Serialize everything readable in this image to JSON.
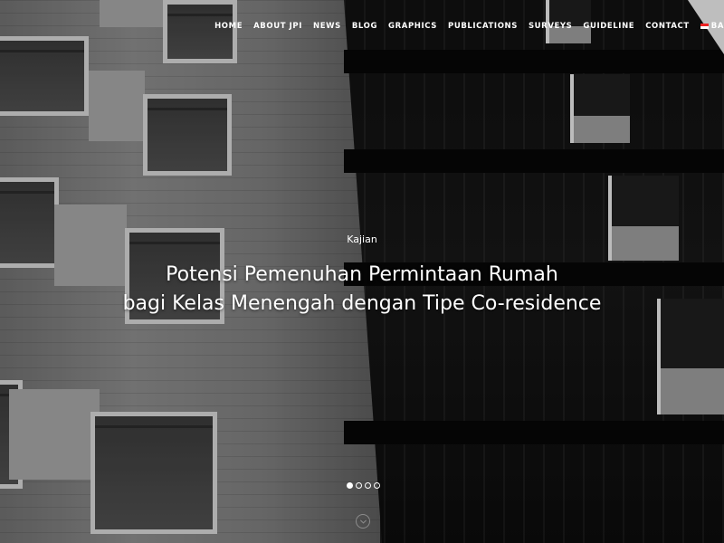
{
  "nav": {
    "items": [
      {
        "label": "HOME"
      },
      {
        "label": "ABOUT JPI"
      },
      {
        "label": "NEWS"
      },
      {
        "label": "BLOG"
      },
      {
        "label": "GRAPHICS"
      },
      {
        "label": "PUBLICATIONS"
      },
      {
        "label": "SURVEYS"
      },
      {
        "label": "GUIDELINE"
      },
      {
        "label": "CONTACT"
      }
    ],
    "language_label": "BA"
  },
  "hero": {
    "category": "Kajian",
    "title_line1": "Potensi Pemenuhan Permintaan Rumah",
    "title_line2": "bagi Kelas Menengah dengan Tipe Co-residence",
    "slides_total": 4,
    "active_slide": 1
  },
  "icons": {
    "scroll": "scroll-down-icon",
    "language": "indonesia-flag-icon"
  },
  "colors": {
    "text": "#ffffff"
  }
}
